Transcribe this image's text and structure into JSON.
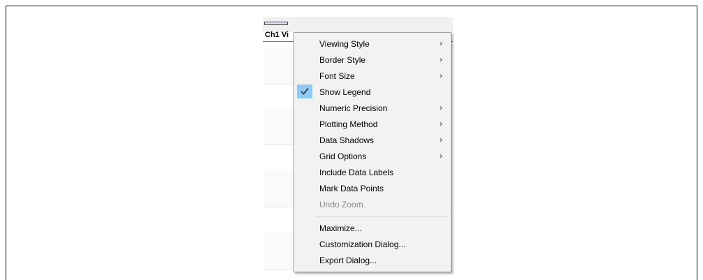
{
  "chart_window": {
    "title": "Ch1 Vi"
  },
  "context_menu": {
    "items": [
      {
        "label": "Viewing Style",
        "submenu": true,
        "checked": false,
        "enabled": true
      },
      {
        "label": "Border Style",
        "submenu": true,
        "checked": false,
        "enabled": true
      },
      {
        "label": "Font Size",
        "submenu": true,
        "checked": false,
        "enabled": true
      },
      {
        "label": "Show Legend",
        "submenu": false,
        "checked": true,
        "enabled": true
      },
      {
        "label": "Numeric Precision",
        "submenu": true,
        "checked": false,
        "enabled": true
      },
      {
        "label": "Plotting Method",
        "submenu": true,
        "checked": false,
        "enabled": true
      },
      {
        "label": "Data Shadows",
        "submenu": true,
        "checked": false,
        "enabled": true
      },
      {
        "label": "Grid Options",
        "submenu": true,
        "checked": false,
        "enabled": true
      },
      {
        "label": "Include Data Labels",
        "submenu": false,
        "checked": false,
        "enabled": true
      },
      {
        "label": "Mark Data Points",
        "submenu": false,
        "checked": false,
        "enabled": true
      },
      {
        "label": "Undo Zoom",
        "submenu": false,
        "checked": false,
        "enabled": false
      },
      {
        "label": "Maximize...",
        "submenu": false,
        "checked": false,
        "enabled": true
      },
      {
        "label": "Customization Dialog...",
        "submenu": false,
        "checked": false,
        "enabled": true
      },
      {
        "label": "Export Dialog...",
        "submenu": false,
        "checked": false,
        "enabled": true
      }
    ],
    "submenu_arrow": "›",
    "check_color": "#90c8f6",
    "icons": {
      "check": "checkmark-icon",
      "submenu": "chevron-right-icon"
    }
  }
}
